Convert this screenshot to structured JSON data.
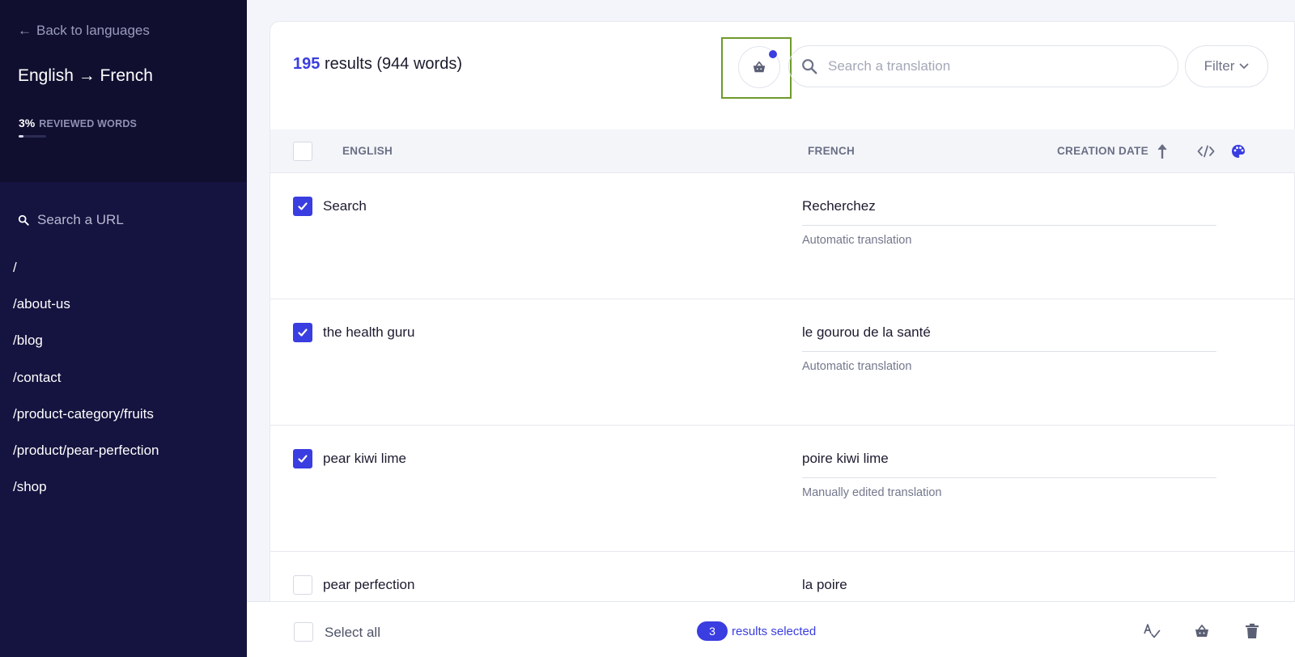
{
  "sidebar": {
    "back_label": "Back to languages",
    "language_pair": "English → French",
    "reviewed_percent": "3%",
    "reviewed_label": "REVIEWED WORDS",
    "reviewed_fraction": 0.03,
    "url_search_placeholder": "Search a URL",
    "urls": [
      "/",
      "/about-us",
      "/blog",
      "/contact",
      "/product-category/fruits",
      "/product/pear-perfection",
      "/shop"
    ]
  },
  "header": {
    "results_count": "195",
    "results_text": "results (944 words)",
    "search_placeholder": "Search a translation",
    "filter_label": "Filter"
  },
  "table": {
    "columns": {
      "source": "ENGLISH",
      "target": "FRENCH",
      "date": "CREATION DATE"
    },
    "rows": [
      {
        "source": "Search",
        "target": "Recherchez",
        "note": "Automatic translation",
        "checked": true
      },
      {
        "source": "the health guru",
        "target": "le gourou de la santé",
        "note": "Automatic translation",
        "checked": true
      },
      {
        "source": "pear kiwi lime",
        "target": "poire kiwi lime",
        "note": "Manually edited translation",
        "checked": true
      },
      {
        "source": "pear perfection",
        "target": "la poire",
        "note": "",
        "checked": false
      }
    ]
  },
  "bottombar": {
    "select_all": "Select all",
    "selected_count": "3",
    "selected_text": "results selected"
  },
  "colors": {
    "accent": "#3a3de0",
    "sidebar_bg": "#15133f",
    "focus_outline": "#6f9a2c"
  }
}
